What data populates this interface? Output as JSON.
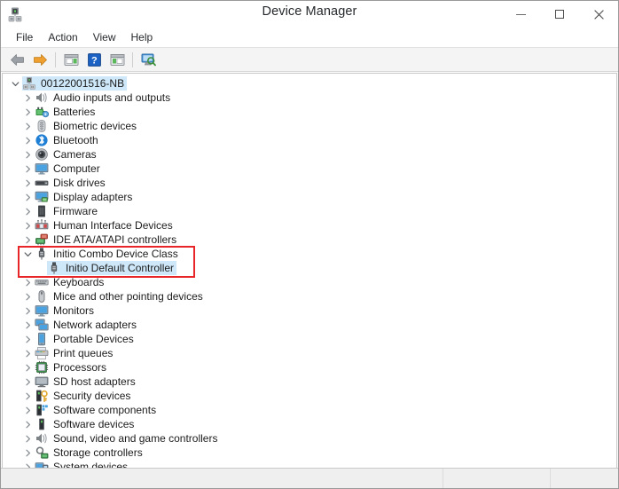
{
  "window": {
    "title": "Device Manager",
    "app_icon": "device-manager-icon",
    "caption": {
      "minimize": "minimize-icon",
      "maximize": "maximize-icon",
      "close": "close-icon"
    }
  },
  "menubar": {
    "items": [
      {
        "label": "File"
      },
      {
        "label": "Action"
      },
      {
        "label": "View"
      },
      {
        "label": "Help"
      }
    ]
  },
  "toolbar": {
    "buttons": [
      {
        "name": "back-button",
        "icon": "back-arrow-icon"
      },
      {
        "name": "forward-button",
        "icon": "forward-arrow-icon"
      },
      {
        "name": "properties-button",
        "icon": "properties-icon"
      },
      {
        "name": "help-button",
        "icon": "help-question-icon"
      },
      {
        "name": "update-driver-button",
        "icon": "update-driver-icon"
      },
      {
        "name": "scan-hardware-changes-button",
        "icon": "scan-hardware-icon"
      }
    ]
  },
  "tree": {
    "root": {
      "label": "00122001516-NB",
      "icon": "computer-node-icon",
      "expanded": true,
      "selected": false,
      "highlighted": true
    },
    "nodes": [
      {
        "label": "Audio inputs and outputs",
        "icon": "speaker-icon",
        "level": 1,
        "expandable": true
      },
      {
        "label": "Batteries",
        "icon": "battery-icon",
        "level": 1,
        "expandable": true
      },
      {
        "label": "Biometric devices",
        "icon": "fingerprint-icon",
        "level": 1,
        "expandable": true
      },
      {
        "label": "Bluetooth",
        "icon": "bluetooth-icon",
        "level": 1,
        "expandable": true
      },
      {
        "label": "Cameras",
        "icon": "camera-icon",
        "level": 1,
        "expandable": true
      },
      {
        "label": "Computer",
        "icon": "monitor-icon",
        "level": 1,
        "expandable": true
      },
      {
        "label": "Disk drives",
        "icon": "disk-drive-icon",
        "level": 1,
        "expandable": true
      },
      {
        "label": "Display adapters",
        "icon": "display-adapter-icon",
        "level": 1,
        "expandable": true
      },
      {
        "label": "Firmware",
        "icon": "firmware-icon",
        "level": 1,
        "expandable": true
      },
      {
        "label": "Human Interface Devices",
        "icon": "hid-icon",
        "level": 1,
        "expandable": true
      },
      {
        "label": "IDE ATA/ATAPI controllers",
        "icon": "ide-controller-icon",
        "level": 1,
        "expandable": true
      },
      {
        "label": "Initio Combo Device Class",
        "icon": "usb-plug-icon",
        "level": 1,
        "expandable": true,
        "expanded": true,
        "annotated": true
      },
      {
        "label": "Initio Default Controller",
        "icon": "usb-device-icon",
        "level": 2,
        "expandable": false,
        "selected": true,
        "annotated": true
      },
      {
        "label": "Keyboards",
        "icon": "keyboard-icon",
        "level": 1,
        "expandable": true
      },
      {
        "label": "Mice and other pointing devices",
        "icon": "mouse-icon",
        "level": 1,
        "expandable": true
      },
      {
        "label": "Monitors",
        "icon": "monitor-icon",
        "level": 1,
        "expandable": true
      },
      {
        "label": "Network adapters",
        "icon": "network-adapter-icon",
        "level": 1,
        "expandable": true
      },
      {
        "label": "Portable Devices",
        "icon": "portable-device-icon",
        "level": 1,
        "expandable": true
      },
      {
        "label": "Print queues",
        "icon": "printer-icon",
        "level": 1,
        "expandable": true
      },
      {
        "label": "Processors",
        "icon": "processor-icon",
        "level": 1,
        "expandable": true
      },
      {
        "label": "SD host adapters",
        "icon": "sd-host-adapter-icon",
        "level": 1,
        "expandable": true
      },
      {
        "label": "Security devices",
        "icon": "security-key-icon",
        "level": 1,
        "expandable": true
      },
      {
        "label": "Software components",
        "icon": "software-component-icon",
        "level": 1,
        "expandable": true
      },
      {
        "label": "Software devices",
        "icon": "software-device-icon",
        "level": 1,
        "expandable": true
      },
      {
        "label": "Sound, video and game controllers",
        "icon": "speaker-icon",
        "level": 1,
        "expandable": true
      },
      {
        "label": "Storage controllers",
        "icon": "storage-controller-icon",
        "level": 1,
        "expandable": true
      },
      {
        "label": "System devices",
        "icon": "system-device-icon",
        "level": 1,
        "expandable": true
      }
    ]
  },
  "colors": {
    "selection": "#cfe8f9",
    "annotation": "#e8262a",
    "toolbar_bg": "#f4f4f4",
    "statusbar_bg": "#efefef"
  },
  "statusbar": {
    "main": "",
    "pane2": "",
    "pane3": ""
  }
}
